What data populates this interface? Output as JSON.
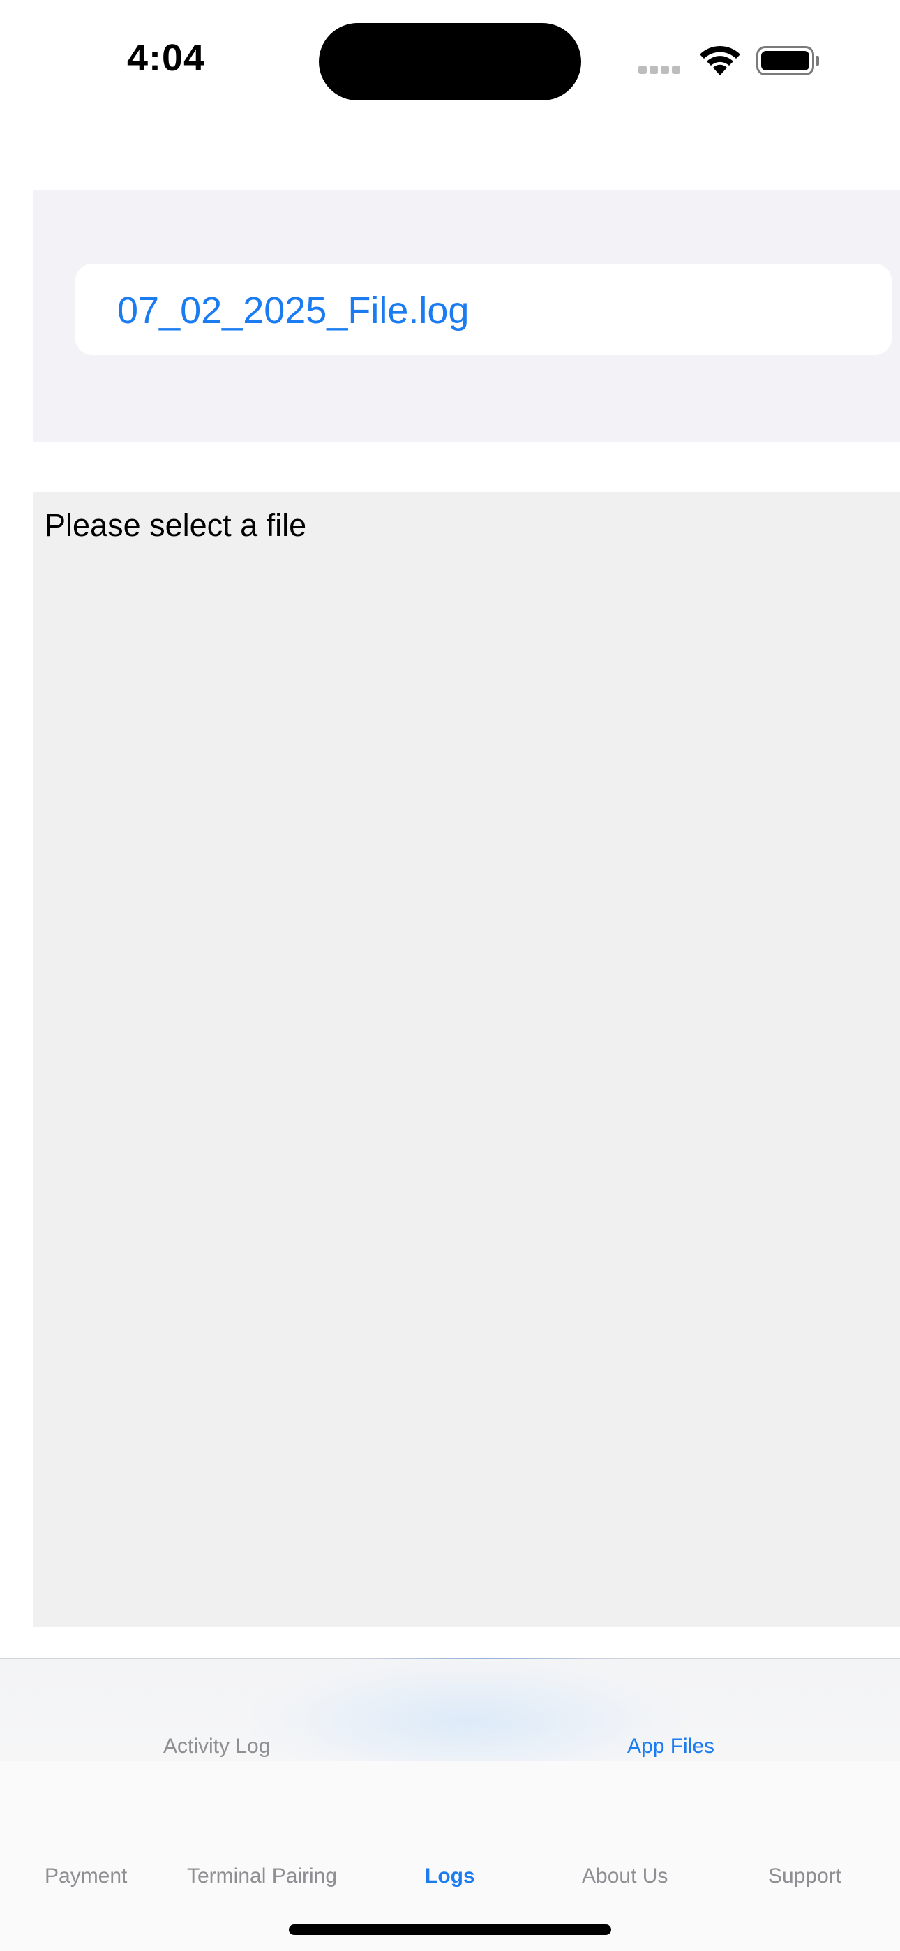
{
  "status_bar": {
    "time": "4:04",
    "icons": [
      "cellular-signal-icon",
      "wifi-icon",
      "battery-icon"
    ]
  },
  "file_list": {
    "items": [
      {
        "label": "07_02_2025_File.log"
      }
    ]
  },
  "log_viewer": {
    "placeholder_text": "Please select a file"
  },
  "sub_tabs": {
    "items": [
      {
        "label": "Activity Log",
        "selected": false
      },
      {
        "label": "App Files",
        "selected": true
      }
    ]
  },
  "tab_bar": {
    "items": [
      {
        "label": "Payment",
        "selected": false
      },
      {
        "label": "Terminal Pairing",
        "selected": false
      },
      {
        "label": "Logs",
        "selected": true
      },
      {
        "label": "About Us",
        "selected": false
      },
      {
        "label": "Support",
        "selected": false
      }
    ]
  },
  "colors": {
    "accent": "#1a7cf0",
    "inactive": "#8e8e93",
    "panel_background": "#f2f2f7",
    "log_background": "#f0f0f1"
  }
}
